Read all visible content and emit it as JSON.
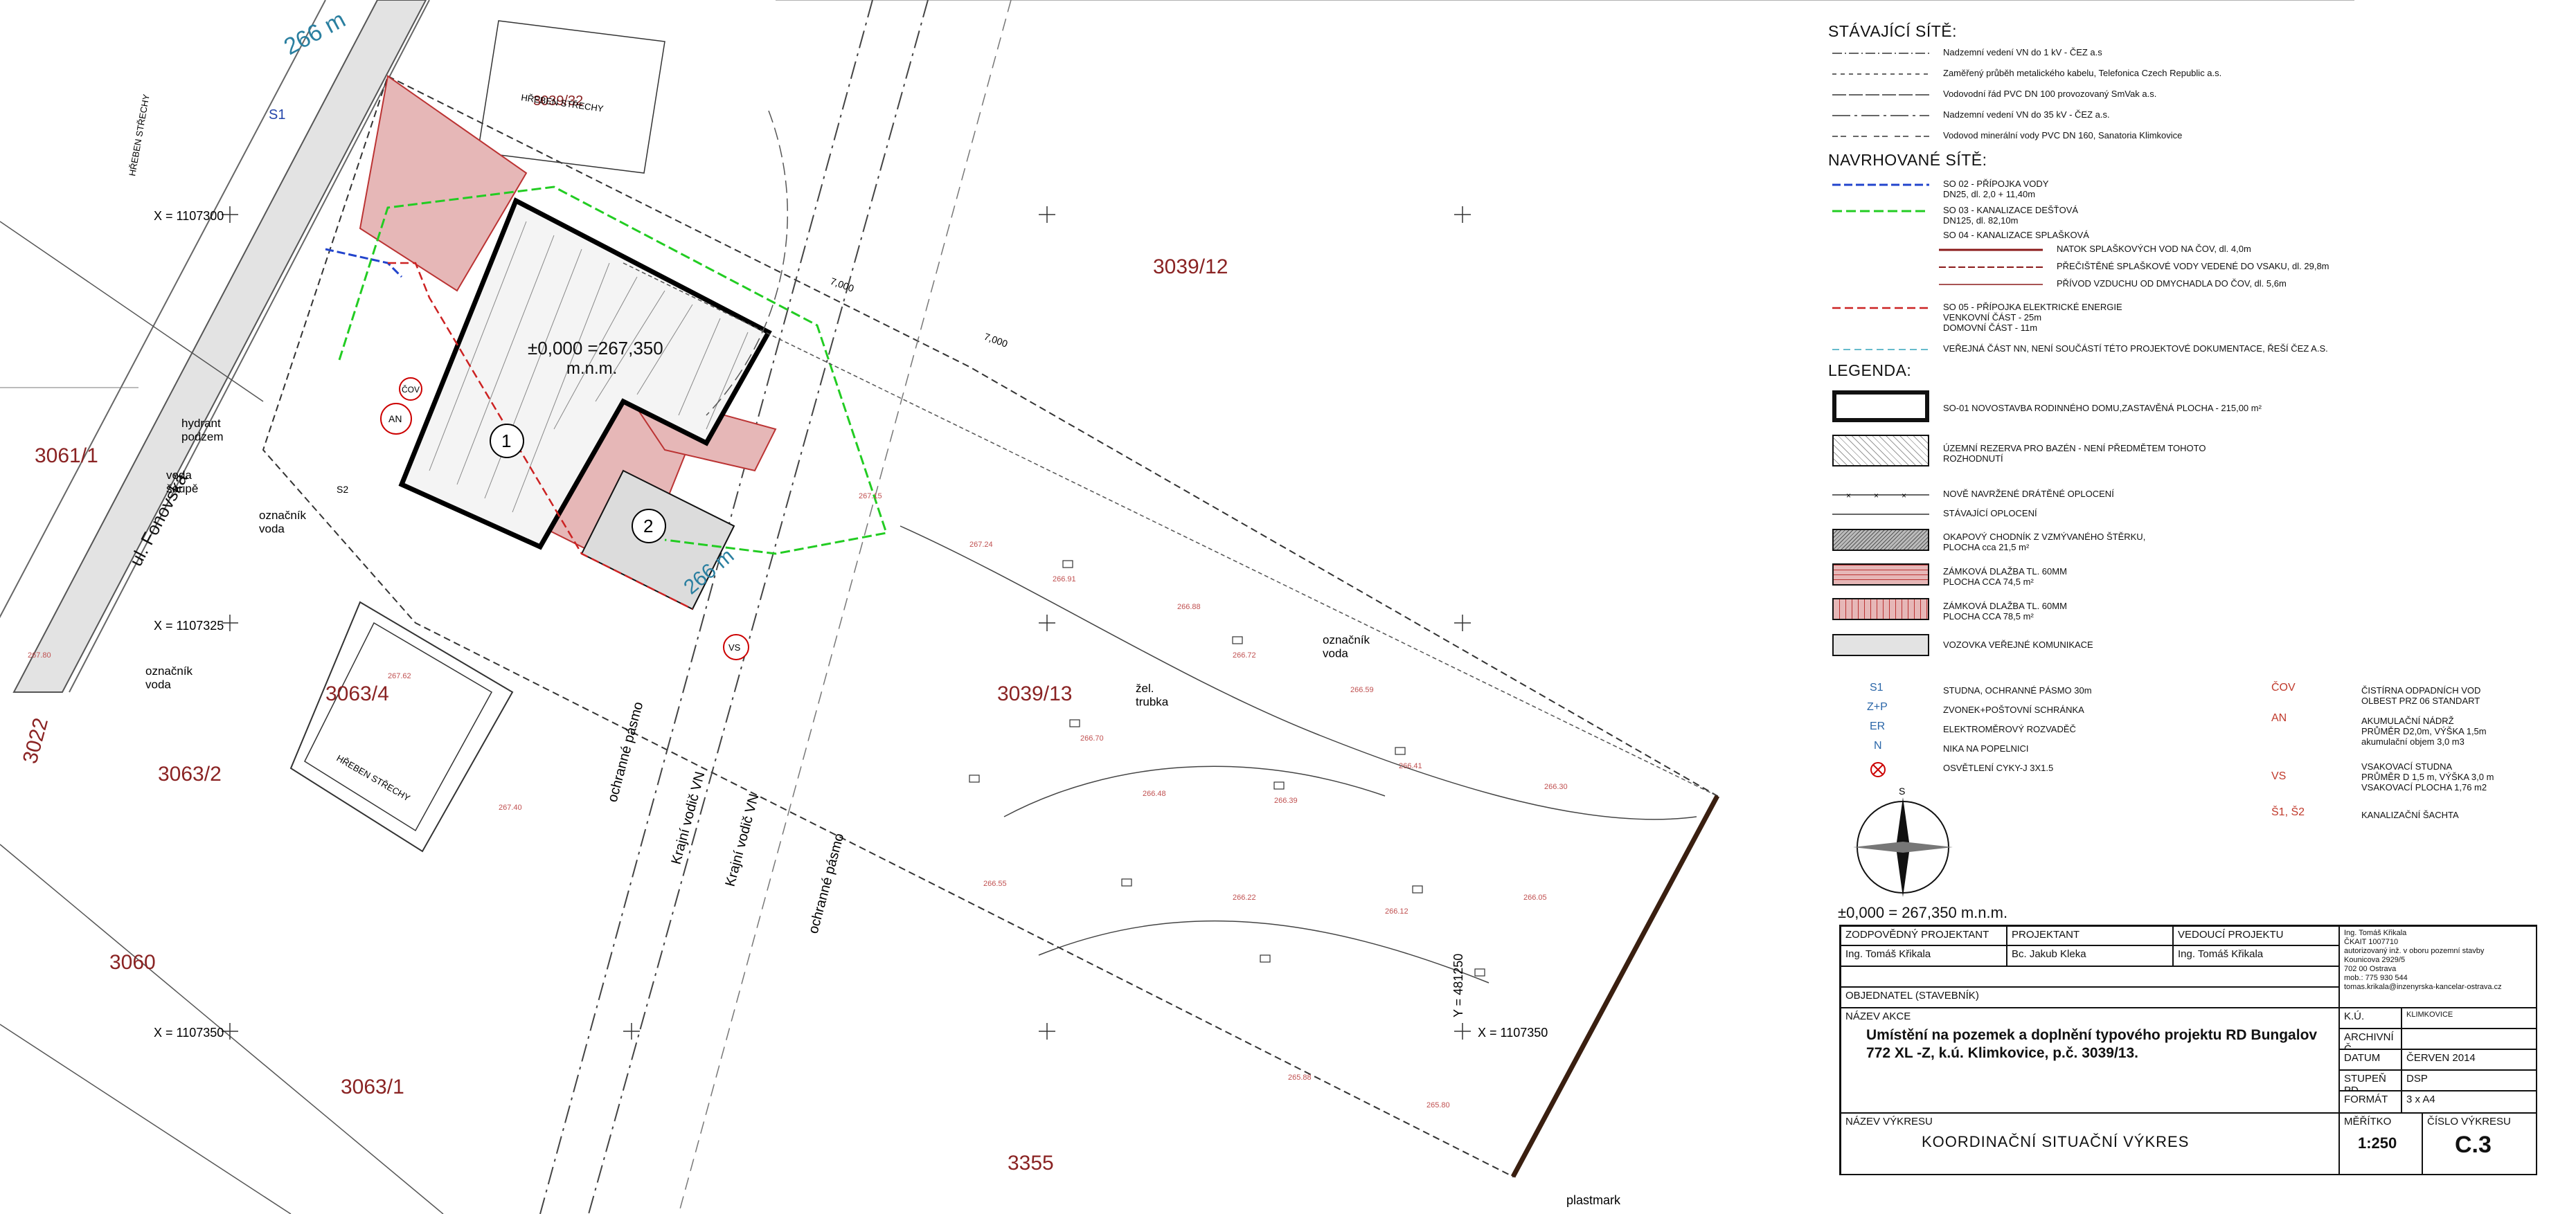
{
  "plan": {
    "parcels": {
      "p3061_1": "3061/1",
      "p3039_12": "3039/12",
      "p3039_13": "3039/13",
      "p3063_4": "3063/4",
      "p3063_2": "3063/2",
      "p3063_1": "3063/1",
      "p3060": "3060",
      "p3022": "3022",
      "p3355": "3355",
      "p3039_32": "3039/32"
    },
    "street": "ul. Fonovská",
    "elevation_label": "±0,000 =267,350",
    "elevation_unit": "m.n.m.",
    "building_1": "1",
    "building_2": "2",
    "coords": {
      "x1": "X = 1107300",
      "x2": "X = 1107325",
      "x3": "X = 1107350",
      "x4": "X = 1107350",
      "y1": "Y = 481250"
    },
    "annotations": {
      "hydrant": "hydrant\npodzem",
      "voda_soupe": "voda\nšoupě",
      "oznacnik_voda_1": "označník\nvoda",
      "oznacnik_voda_2": "označník\nvoda",
      "oznacnik_voda_3": "označník\nvoda",
      "zel_trubka": "žel.\ntrubka",
      "krajni_vodic_1": "Krajní vodič VN",
      "krajni_vodic_2": "Krajní vodič VN",
      "ochranne_pasmo_1": "ochranné pásmo",
      "ochranne_pasmo_2": "ochranné pásmo",
      "plastmark": "plastmark",
      "s1": "S1",
      "s2": "S2",
      "an": "AN",
      "cov": "ČOV",
      "vs": "VS",
      "hreben_1": "HŘEBEN STŘECHY",
      "hreben_2": "HŘEBEN STŘECHY",
      "hreben_3": "HŘEBEN STŘECHY",
      "elev_266_a": "266 m",
      "elev_266_b": "266 m",
      "dim_7000": "7,000",
      "dim_7000b": "7,000"
    }
  },
  "legend": {
    "existing_title": "STÁVAJÍCÍ SÍTĚ:",
    "existing": [
      "Nadzemní vedení VN do 1 kV - ČEZ a.s",
      "Zaměřený průběh metalického kabelu, Telefonica Czech Republic a.s.",
      "Vodovodní řád PVC DN 100 provozovaný SmVak a.s.",
      "Nadzemní vedení VN do 35 kV - ČEZ a.s.",
      "Vodovod minerální vody PVC DN 160, Sanatoria Klimkovice"
    ],
    "proposed_title": "NAVRHOVANÉ SÍTĚ:",
    "proposed": [
      "SO 02 - PŘÍPOJKA VODY\n     DN25, dl. 2,0 + 11,40m",
      "SO 03 - KANALIZACE DEŠŤOVÁ\n     DN125, dl. 82,10m",
      "SO 04 - KANALIZACE SPLAŠKOVÁ",
      "NATOK SPLAŠKOVÝCH VOD NA ČOV, dl. 4,0m",
      "PŘEČIŠTĚNÉ SPLAŠKOVÉ VODY VEDENÉ DO VSAKU, dl. 29,8m",
      "PŘÍVOD VZDUCHU OD DMYCHADLA DO ČOV, dl. 5,6m",
      "SO 05 - PŘÍPOJKA ELEKTRICKÉ ENERGIE\n     VENKOVNÍ ČÁST - 25m\n     DOMOVNÍ ČÁST - 11m",
      "VEŘEJNÁ ČÁST NN, NENÍ SOUČÁSTÍ TÉTO PROJEKTOVÉ DOKUMENTACE, ŘEŠÍ ČEZ A.S."
    ],
    "legend_title": "LEGENDA:",
    "items": [
      "SO-01 NOVOSTAVBA RODINNÉHO DOMU,ZASTAVĚNÁ PLOCHA - 215,00 m²",
      "ÚZEMNÍ REZERVA PRO BAZÉN - NENÍ PŘEDMĚTEM TOHOTO\nROZHODNUTÍ",
      "NOVĚ NAVRŽENÉ DRÁTĚNÉ OPLOCENÍ",
      "STÁVAJÍCÍ OPLOCENÍ",
      "OKAPOVÝ CHODNÍK Z VZMÝVANÉHO ŠTĚRKU,\n PLOCHA cca 21,5 m²",
      "ZÁMKOVÁ DLAŽBA TL. 60MM\n PLOCHA CCA 74,5 m²",
      "ZÁMKOVÁ DLAŽBA TL. 60MM\n PLOCHA CCA 78,5 m²",
      "VOZOVKA VEŘEJNÉ KOMUNIKACE"
    ],
    "symbols": [
      {
        "code": "S1",
        "text": "STUDNA, OCHRANNÉ PÁSMO 30m"
      },
      {
        "code": "Z+P",
        "text": "ZVONEK+POŠTOVNÍ SCHRÁNKA"
      },
      {
        "code": "ER",
        "text": "ELEKTROMĚROVÝ ROZVADĚČ"
      },
      {
        "code": "N",
        "text": "NIKA NA POPELNICI"
      },
      {
        "code": "",
        "text": "OSVĚTLENÍ CYKY-J 3X1.5"
      }
    ],
    "symbols_right": [
      {
        "code": "ČOV",
        "text": "ČISTÍRNA ODPADNÍCH VOD\nOLBEST PRZ 06 STANDART"
      },
      {
        "code": "AN",
        "text": "AKUMULAČNÍ NÁDRŽ\nPRŮMĚR D2,0m, VÝŠKA 1,5m\nakumulační objem 3,0 m3"
      },
      {
        "code": "VS",
        "text": "VSAKOVACÍ STUDNA\nPRŮMĚR D 1,5 m, VÝŠKA 3,0 m\nVSAKOVACÍ PLOCHA 1,76 m2"
      },
      {
        "code": "Š1, Š2",
        "text": "KANALIZAČNÍ ŠACHTA"
      }
    ],
    "datum_line": "±0,000 = 267,350 m.n.m."
  },
  "titleblock": {
    "h_resp": "ZODPOVĚDNÝ PROJEKTANT",
    "h_proj": "PROJEKTANT",
    "h_lead": "VEDOUCÍ PROJEKTU",
    "resp": "Ing. Tomáš Křikala",
    "proj": "Bc. Jakub Kleka",
    "lead": "Ing. Tomáš Křikala",
    "stamp": "Ing. Tomáš Křikala\nČKAIT 1007710\nautorizovaný inž. v oboru pozemní stavby\nKounicova 2929/5\n702 00 Ostrava\nmob.: 775 930 544\ntomas.krikala@inzenyrska-kancelar-ostrava.cz",
    "h_client": "OBJEDNATEL (STAVEBNÍK)",
    "h_action": "NÁZEV AKCE",
    "action": "Umístění na pozemek a doplnění typového projektu RD Bungalov\n772 XL -Z, k.ú. Klimkovice, p.č. 3039/13.",
    "h_ku": "K.Ú.",
    "ku": "KLIMKOVICE",
    "h_arch": "ARCHIVNÍ Č.",
    "h_date": "DATUM",
    "date": "ČERVEN 2014",
    "h_stage": "STUPEŇ PD",
    "stage": "DSP",
    "h_format": "FORMÁT",
    "format": "3 x A4",
    "h_drawing": "NÁZEV VÝKRESU",
    "drawing": "KOORDINAČNÍ SITUAČNÍ VÝKRES",
    "h_scale": "MĚŘÍTKO",
    "scale": "1:250",
    "h_number": "ČÍSLO VÝKRESU",
    "number": "C.3"
  }
}
